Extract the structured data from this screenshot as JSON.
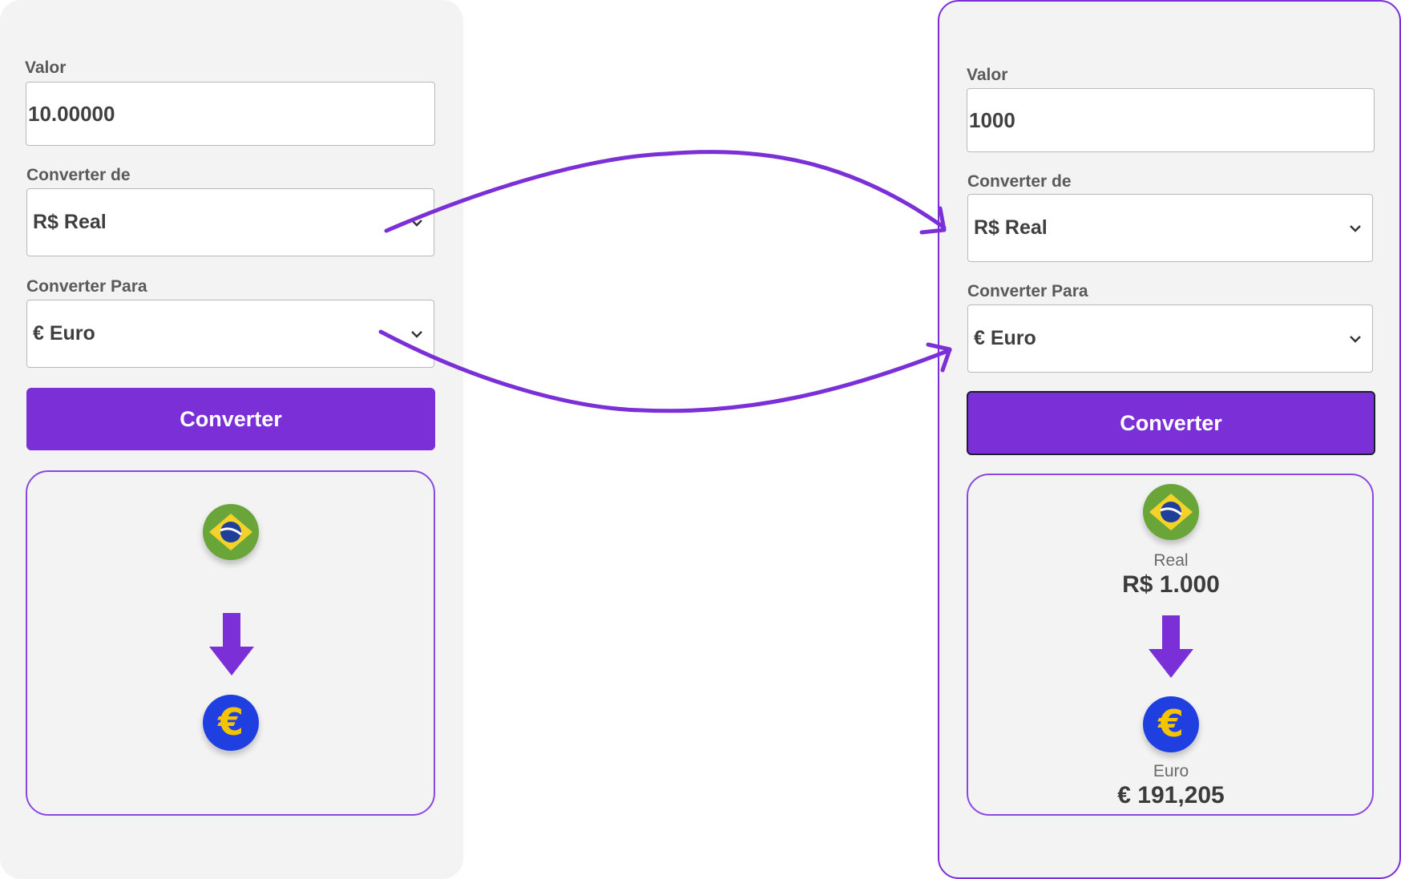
{
  "left": {
    "valor_label": "Valor",
    "valor_value": "10.00000",
    "de_label": "Converter de",
    "de_selected": "R$ Real",
    "para_label": "Converter Para",
    "para_selected": "€ Euro",
    "button_label": "Converter"
  },
  "right": {
    "valor_label": "Valor",
    "valor_value": "1000",
    "de_label": "Converter de",
    "de_selected": "R$ Real",
    "para_label": "Converter Para",
    "para_selected": "€ Euro",
    "button_label": "Converter",
    "result": {
      "from_name": "Real",
      "from_amount": "R$ 1.000",
      "to_name": "Euro",
      "to_amount": "€ 191,205"
    }
  },
  "colors": {
    "accent": "#7b2fd6",
    "panel_bg": "#f3f3f3",
    "brazil_green": "#6aa53a",
    "brazil_yellow": "#f5d22a",
    "brazil_blue": "#1f3f9a",
    "euro_blue": "#1f3fe0",
    "euro_yellow": "#f5c400"
  },
  "icons": [
    "brazil-flag-icon",
    "euro-flag-icon",
    "down-arrow-icon",
    "chevron-down-icon",
    "connector-arrow-icon"
  ]
}
